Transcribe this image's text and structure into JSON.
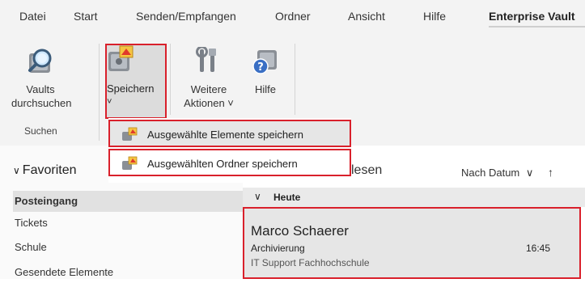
{
  "menu": {
    "tabs": [
      "Datei",
      "Start",
      "Senden/Empfangen",
      "Ordner",
      "Ansicht",
      "Hilfe",
      "Enterprise Vault"
    ]
  },
  "ribbon": {
    "vaults_search": {
      "line1": "Vaults",
      "line2": "durchsuchen",
      "icon": "vault-search-icon"
    },
    "save": {
      "line1": "Speichern",
      "chevron": "˅",
      "icon": "vault-save-icon"
    },
    "more_actions": {
      "line1": "Weitere",
      "line2": "Aktionen ˅",
      "icon": "tools-icon"
    },
    "help": {
      "line1": "Hilfe",
      "icon": "vault-help-icon"
    },
    "group_search_label": "Suchen"
  },
  "dropdown": {
    "items": [
      {
        "label": "Ausgewählte Elemente speichern",
        "icon": "save-items-icon"
      },
      {
        "label": "Ausgewählten Ordner speichern",
        "icon": "save-folder-icon"
      }
    ]
  },
  "nav": {
    "favorites_label": "Favoriten",
    "folders": [
      "Posteingang",
      "Tickets",
      "Schule",
      "Gesendete Elemente"
    ]
  },
  "mail_list": {
    "filter_partial": "lesen",
    "sort_label": "Nach Datum",
    "group_label": "Heute",
    "messages": [
      {
        "sender": "Marco Schaerer",
        "subject": "Archivierung",
        "time": "16:45",
        "preview": "IT Support  Fachhochschule"
      }
    ]
  },
  "colors": {
    "highlight": "#d9202b",
    "background": "#f3f3f3"
  }
}
